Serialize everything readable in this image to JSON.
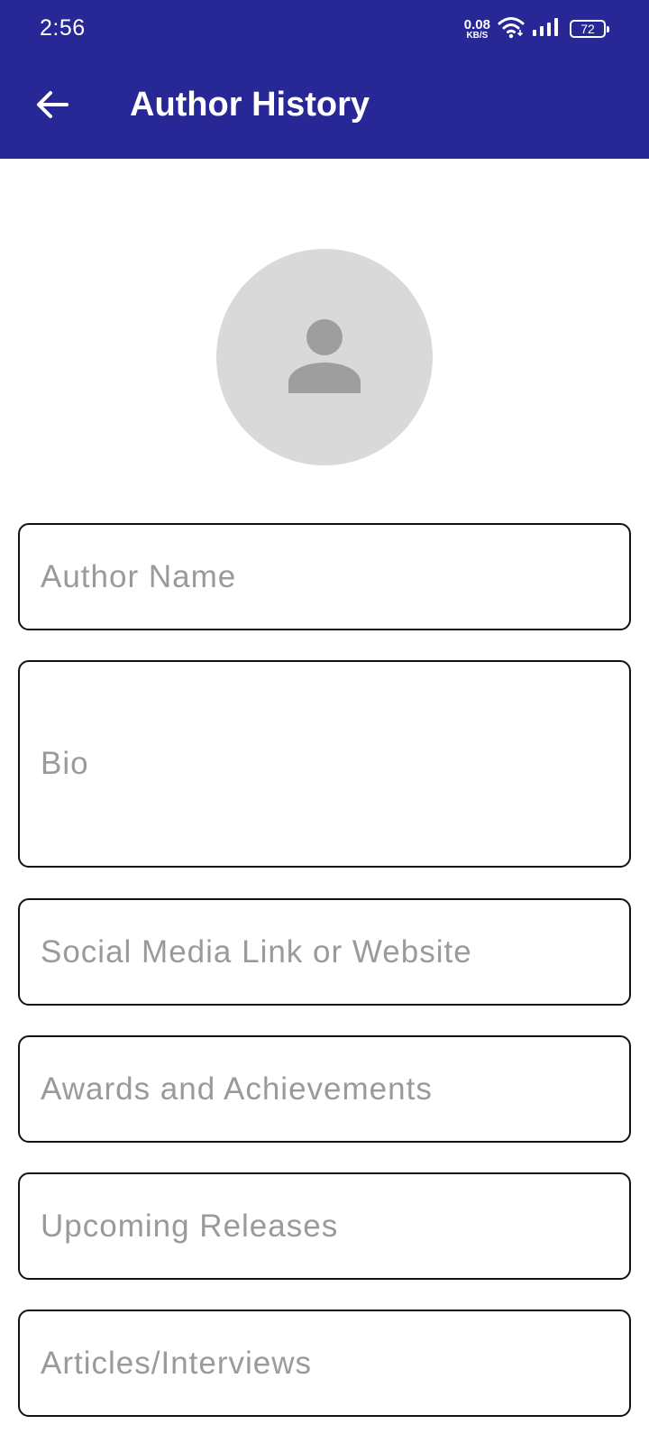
{
  "status_bar": {
    "time": "2:56",
    "net_speed_value": "0.08",
    "net_speed_unit": "KB/S",
    "battery_level": "72",
    "icons": [
      "wifi-icon",
      "signal-icon",
      "battery-icon"
    ]
  },
  "app_bar": {
    "title": "Author History",
    "back_icon": "arrow-left-icon"
  },
  "avatar": {
    "icon": "person-icon"
  },
  "form": {
    "author_name_placeholder": "Author Name",
    "bio_placeholder": "Bio",
    "social_placeholder": "Social Media Link or Website",
    "awards_placeholder": "Awards and Achievements",
    "upcoming_placeholder": "Upcoming Releases",
    "articles_placeholder": "Articles/Interviews"
  },
  "colors": {
    "app_bar": "#272796",
    "avatar_bg": "#d9d9d9",
    "avatar_icon": "#9e9e9e",
    "placeholder": "#9a9a9a",
    "field_border": "#111111"
  }
}
